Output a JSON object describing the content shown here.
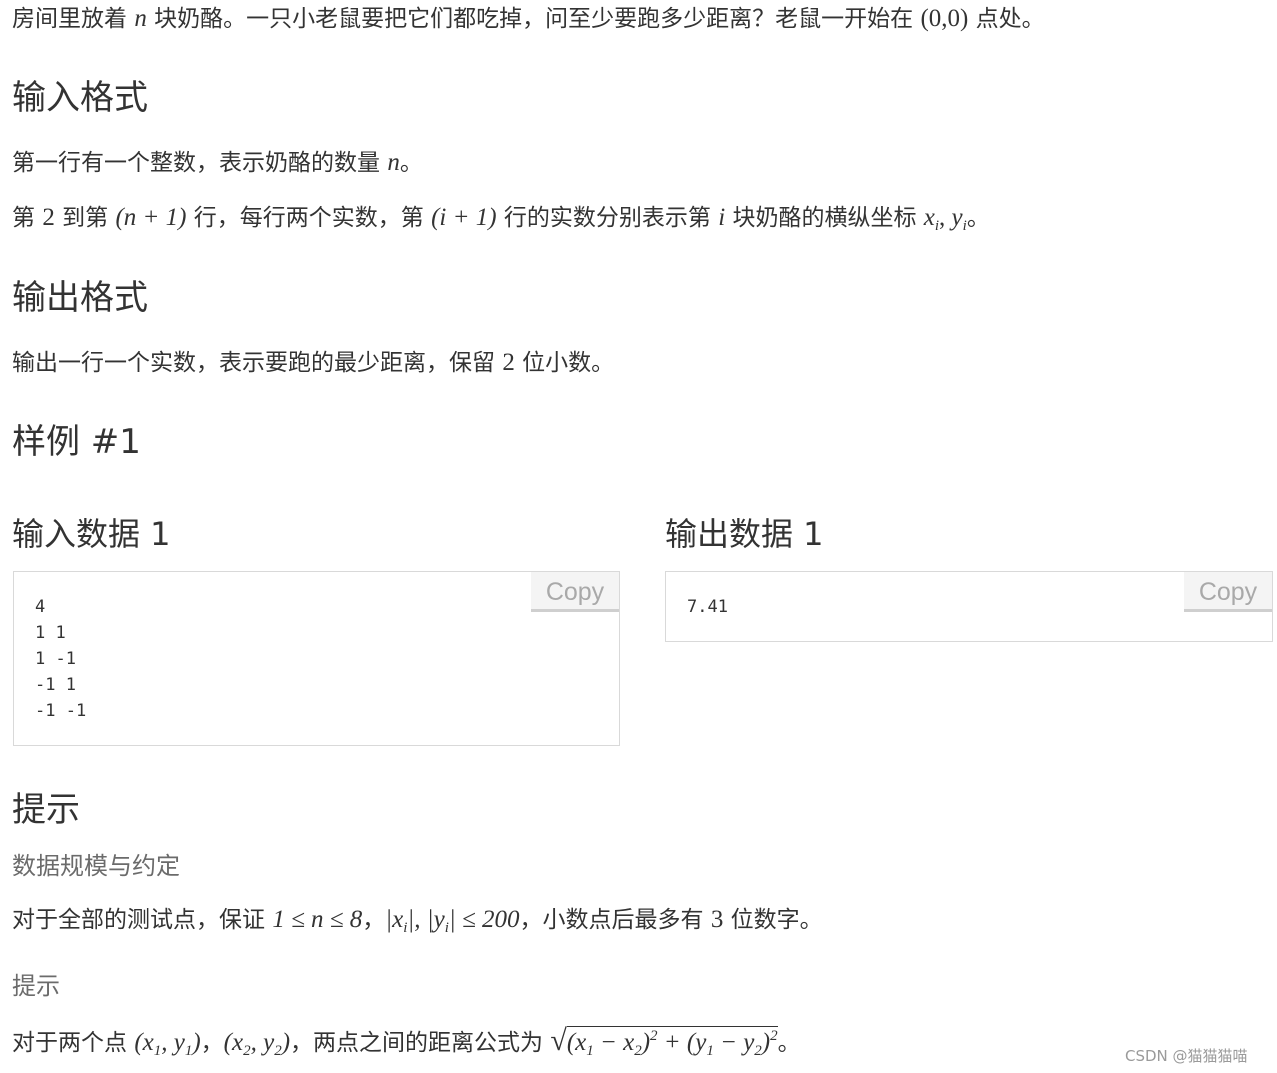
{
  "statement": {
    "p1": {
      "a": "房间里放着",
      "n": "n",
      "b": "块奶酪。一只小老鼠要把它们都吃掉，问至少要跑多少距离？老鼠一开始在",
      "origin": "(0,0)",
      "c": "点处。"
    }
  },
  "input_format": {
    "heading": "输入格式",
    "line1": {
      "a": "第一行有一个整数，表示奶酪的数量",
      "n": "n",
      "b": "。"
    },
    "line2": {
      "a": "第",
      "two": "2",
      "b": "到第",
      "expr1": "(n + 1)",
      "c": "行，每行两个实数，第",
      "expr2": "(i + 1)",
      "d": "行的实数分别表示第",
      "i": "i",
      "e": "块奶酪的横纵坐标",
      "x": "x",
      "xi": "i",
      "comma": ",",
      "y": "y",
      "yi": "i",
      "f": "。"
    }
  },
  "output_format": {
    "heading": "输出格式",
    "line1": {
      "a": "输出一行一个实数，表示要跑的最少距离，保留",
      "two": "2",
      "b": "位小数。"
    }
  },
  "sample": {
    "heading": "样例 #1",
    "input_title": "输入数据 1",
    "output_title": "输出数据 1",
    "input_code": "4\n1 1\n1 -1\n-1 1\n-1 -1",
    "output_code": "7.41",
    "copy_label": "Copy"
  },
  "hint": {
    "heading": "提示",
    "constraints_title": "数据规模与约定",
    "constraints": {
      "a": "对于全部的测试点，保证",
      "range": "1 ≤ n ≤ 8",
      "b": "，",
      "abs": "|x",
      "absi": "i",
      "abs2": "|, |y",
      "absi2": "i",
      "abs3": "| ≤ 200",
      "c": "，小数点后最多有",
      "three": "3",
      "d": "位数字。"
    },
    "tip_title": "提示",
    "tip": {
      "a": "对于两个点",
      "p1": "(x",
      "p1s": "1",
      "p1b": ", y",
      "p1s2": "1",
      "p1c": ")",
      "sep": "，",
      "p2": "(x",
      "p2s": "2",
      "p2b": ", y",
      "p2s2": "2",
      "p2c": ")",
      "b": "，两点之间的距离公式为",
      "f1": "(x",
      "f1s": "1",
      "f1b": " − x",
      "f1s2": "2",
      "f1c": ")",
      "f1p": "2",
      "f2": " + (y",
      "f2s": "1",
      "f2b": " − y",
      "f2s2": "2",
      "f2c": ")",
      "f2p": "2",
      "c": "。"
    }
  },
  "watermark": "CSDN @猫猫猫喵"
}
